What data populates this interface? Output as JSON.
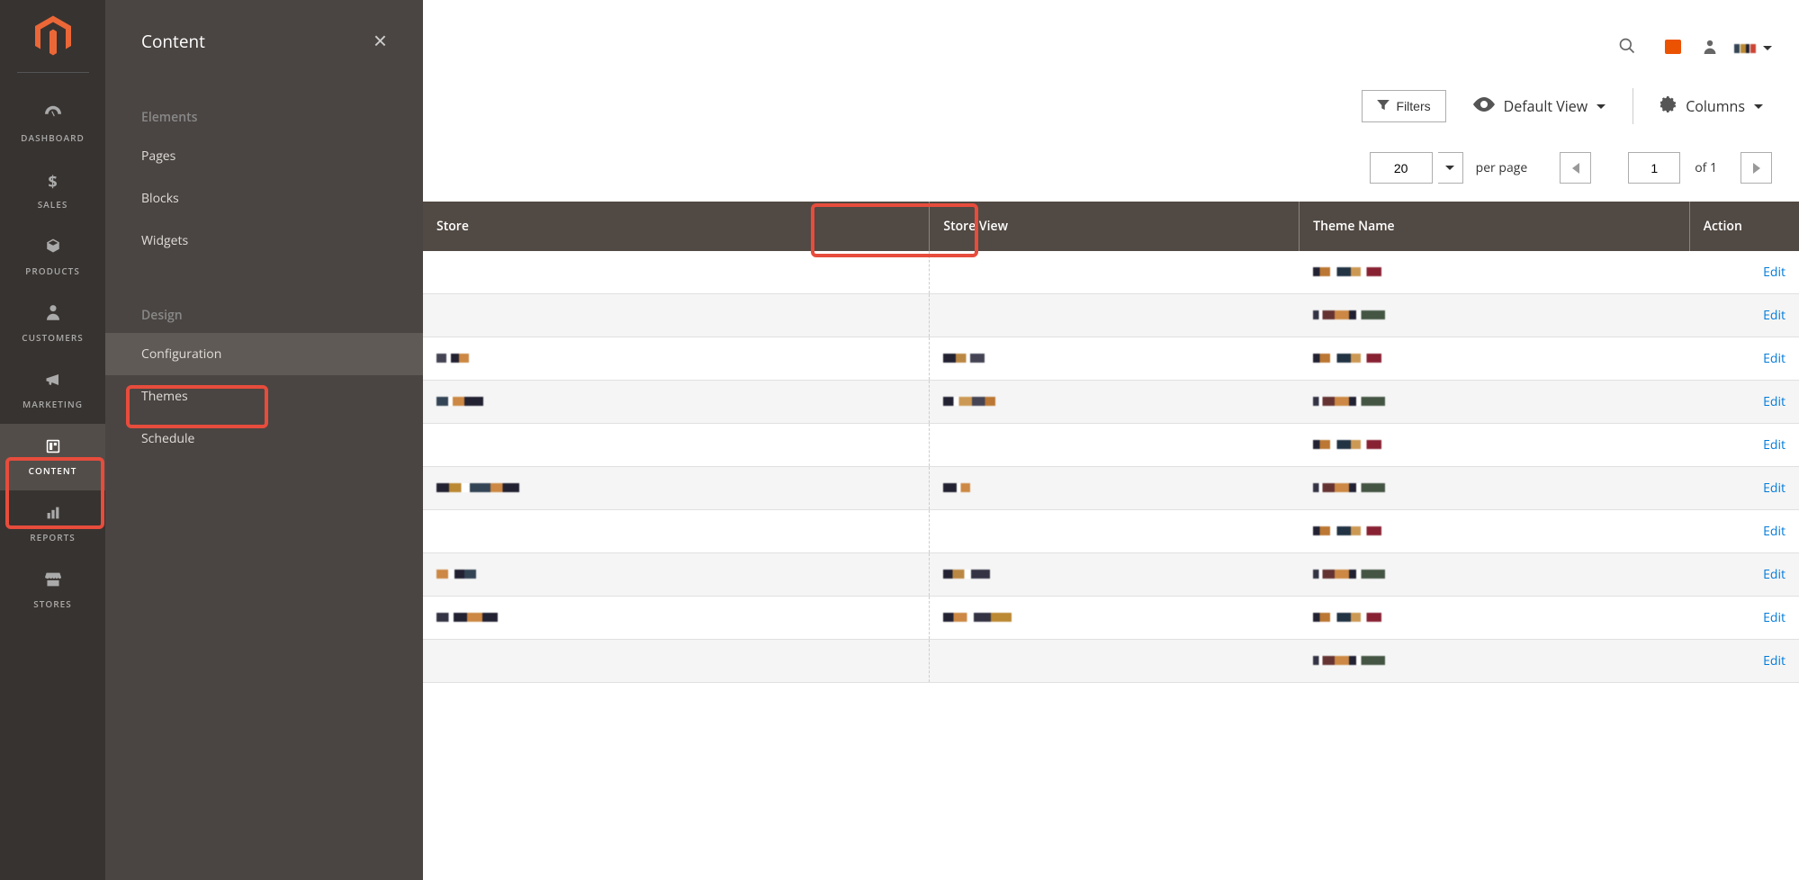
{
  "sidebar": {
    "items": [
      {
        "key": "dashboard",
        "label": "DASHBOARD",
        "icon_name": "dashboard-icon"
      },
      {
        "key": "sales",
        "label": "SALES",
        "icon_name": "dollar-icon"
      },
      {
        "key": "products",
        "label": "PRODUCTS",
        "icon_name": "cube-icon"
      },
      {
        "key": "customers",
        "label": "CUSTOMERS",
        "icon_name": "person-icon"
      },
      {
        "key": "marketing",
        "label": "MARKETING",
        "icon_name": "megaphone-icon"
      },
      {
        "key": "content",
        "label": "CONTENT",
        "icon_name": "content-icon"
      },
      {
        "key": "reports",
        "label": "REPORTS",
        "icon_name": "reports-icon"
      },
      {
        "key": "stores",
        "label": "STORES",
        "icon_name": "stores-icon"
      }
    ],
    "active": "content"
  },
  "submenu": {
    "title": "Content",
    "sections": [
      {
        "title": "Elements",
        "items": [
          {
            "key": "pages",
            "label": "Pages"
          },
          {
            "key": "blocks",
            "label": "Blocks"
          },
          {
            "key": "widgets",
            "label": "Widgets"
          }
        ]
      },
      {
        "title": "Design",
        "items": [
          {
            "key": "configuration",
            "label": "Configuration",
            "active": true
          },
          {
            "key": "themes",
            "label": "Themes"
          },
          {
            "key": "schedule",
            "label": "Schedule"
          }
        ]
      }
    ]
  },
  "toolbar": {
    "filters": "Filters",
    "default_view": "Default View",
    "columns": "Columns"
  },
  "pager": {
    "page_size": "20",
    "per_page_label": "per page",
    "current_page": "1",
    "of_label": "of 1"
  },
  "table": {
    "columns": {
      "store": "Store",
      "store_view": "Store View",
      "theme_name": "Theme Name",
      "action": "Action"
    },
    "edit_label": "Edit",
    "rows": [
      {
        "store_px": "",
        "sv_px": "",
        "theme_px": "px-theme1"
      },
      {
        "store_px": "",
        "sv_px": "",
        "theme_px": "px-theme2"
      },
      {
        "store_px": "px-store1",
        "sv_px": "px-sv1",
        "theme_px": "px-theme1"
      },
      {
        "store_px": "px-store2",
        "sv_px": "px-sv2",
        "theme_px": "px-theme2"
      },
      {
        "store_px": "",
        "sv_px": "",
        "theme_px": "px-theme1"
      },
      {
        "store_px": "px-store3",
        "sv_px": "px-sv3",
        "theme_px": "px-theme2"
      },
      {
        "store_px": "",
        "sv_px": "",
        "theme_px": "px-theme1"
      },
      {
        "store_px": "px-store4",
        "sv_px": "px-sv4",
        "theme_px": "px-theme2"
      },
      {
        "store_px": "px-store5",
        "sv_px": "px-sv5",
        "theme_px": "px-theme1"
      },
      {
        "store_px": "",
        "sv_px": "",
        "theme_px": "px-theme2"
      }
    ]
  }
}
